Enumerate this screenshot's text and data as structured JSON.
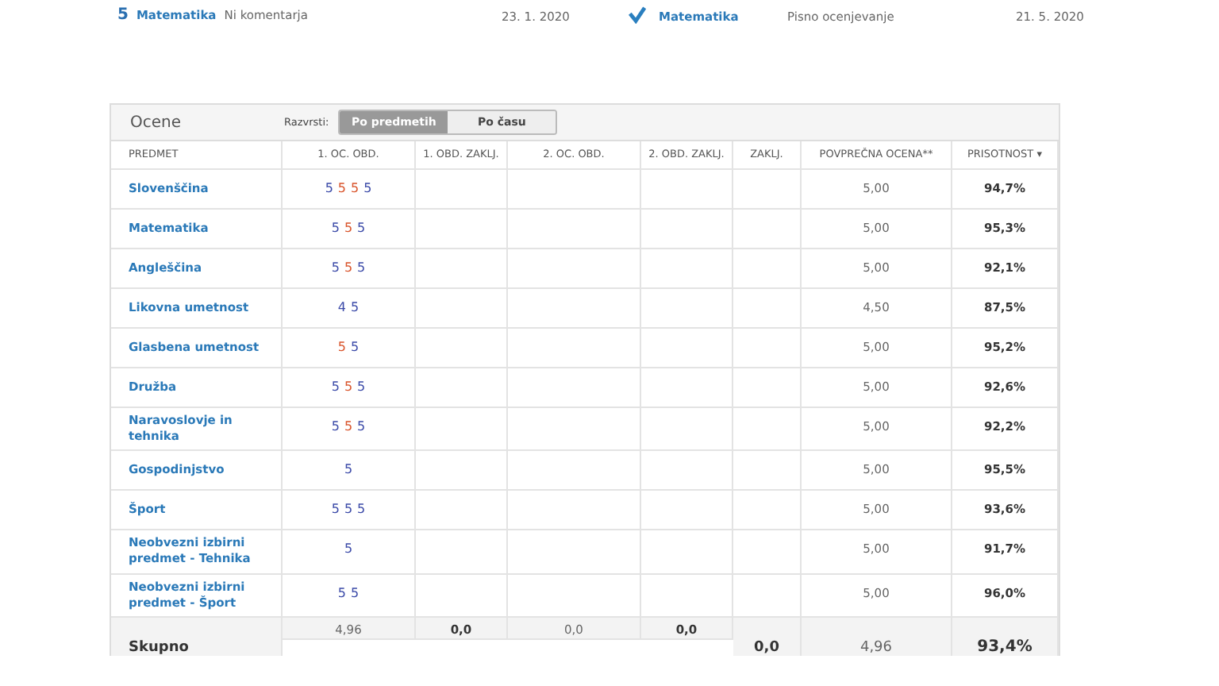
{
  "recent": {
    "left": {
      "grade": "5",
      "subject": "Matematika",
      "comment": "Ni komentarja",
      "date": "23. 1. 2020"
    },
    "right": {
      "subject": "Matematika",
      "type": "Pisno ocenjevanje",
      "date": "21. 5. 2020"
    }
  },
  "grades_panel": {
    "title": "Ocene",
    "sort_label": "Razvrsti:",
    "sort_options": [
      {
        "label": "Po predmetih",
        "selected": true
      },
      {
        "label": "Po času",
        "selected": false
      }
    ],
    "columns": [
      "PREDMET",
      "1. OC. OBD.",
      "1. OBD. ZAKLJ.",
      "2. OC. OBD.",
      "2. OBD. ZAKLJ.",
      "ZAKLJ.",
      "POVPREČNA OCENA**",
      "PRISOTNOST ▾"
    ],
    "rows": [
      {
        "subject": "Slovenščina",
        "grades": [
          {
            "value": "5",
            "color": "#3b4aa8"
          },
          {
            "value": "5",
            "color": "#d9542b"
          },
          {
            "value": "5",
            "color": "#d9542b"
          },
          {
            "value": "5",
            "color": "#3b4aa8"
          }
        ],
        "average": "5,00",
        "attendance": "94,7%"
      },
      {
        "subject": "Matematika",
        "grades": [
          {
            "value": "5",
            "color": "#3b4aa8"
          },
          {
            "value": "5",
            "color": "#d9542b"
          },
          {
            "value": "5",
            "color": "#3b4aa8"
          }
        ],
        "average": "5,00",
        "attendance": "95,3%"
      },
      {
        "subject": "Angleščina",
        "grades": [
          {
            "value": "5",
            "color": "#3b4aa8"
          },
          {
            "value": "5",
            "color": "#d9542b"
          },
          {
            "value": "5",
            "color": "#3b4aa8"
          }
        ],
        "average": "5,00",
        "attendance": "92,1%"
      },
      {
        "subject": "Likovna umetnost",
        "grades": [
          {
            "value": "4",
            "color": "#3b4aa8"
          },
          {
            "value": "5",
            "color": "#3b4aa8"
          }
        ],
        "average": "4,50",
        "attendance": "87,5%"
      },
      {
        "subject": "Glasbena umetnost",
        "grades": [
          {
            "value": "5",
            "color": "#d9542b"
          },
          {
            "value": "5",
            "color": "#3b4aa8"
          }
        ],
        "average": "5,00",
        "attendance": "95,2%"
      },
      {
        "subject": "Družba",
        "grades": [
          {
            "value": "5",
            "color": "#3b4aa8"
          },
          {
            "value": "5",
            "color": "#d9542b"
          },
          {
            "value": "5",
            "color": "#3b4aa8"
          }
        ],
        "average": "5,00",
        "attendance": "92,6%"
      },
      {
        "subject": "Naravoslovje in tehnika",
        "grades": [
          {
            "value": "5",
            "color": "#3b4aa8"
          },
          {
            "value": "5",
            "color": "#d9542b"
          },
          {
            "value": "5",
            "color": "#3b4aa8"
          }
        ],
        "average": "5,00",
        "attendance": "92,2%"
      },
      {
        "subject": "Gospodinjstvo",
        "grades": [
          {
            "value": "5",
            "color": "#3b4aa8"
          }
        ],
        "average": "5,00",
        "attendance": "95,5%"
      },
      {
        "subject": "Šport",
        "grades": [
          {
            "value": "5",
            "color": "#3b4aa8"
          },
          {
            "value": "5",
            "color": "#3b4aa8"
          },
          {
            "value": "5",
            "color": "#3b4aa8"
          }
        ],
        "average": "5,00",
        "attendance": "93,6%"
      },
      {
        "subject": "Neobvezni izbirni predmet - Tehnika",
        "grades": [
          {
            "value": "5",
            "color": "#3b4aa8"
          }
        ],
        "average": "5,00",
        "attendance": "91,7%"
      },
      {
        "subject": "Neobvezni izbirni predmet - Šport",
        "grades": [
          {
            "value": "5",
            "color": "#3b4aa8"
          },
          {
            "value": "5",
            "color": "#3b4aa8"
          }
        ],
        "average": "5,00",
        "attendance": "96,0%"
      }
    ],
    "total": {
      "label": "Skupno",
      "first_period": "4,96",
      "first_final": "0,0",
      "second_period": "0,0",
      "second_final": "0,0",
      "final": "0,0",
      "average": "4,96",
      "attendance": "93,4%"
    }
  }
}
